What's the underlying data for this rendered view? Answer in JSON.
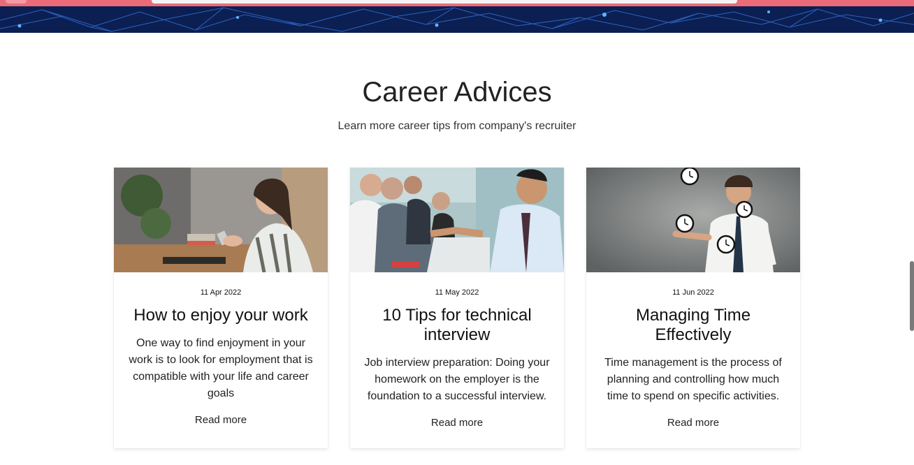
{
  "section": {
    "title": "Career Advices",
    "subtitle": "Learn more career tips from company's recruiter"
  },
  "cards": [
    {
      "image": "woman-smiling-at-phone-photo",
      "date": "11 Apr 2022",
      "title": "How to enjoy your work",
      "excerpt": "One way to find enjoyment in your work is to look for employment that is compatible with your life and career goals",
      "cta": "Read more"
    },
    {
      "image": "business-handshake-meeting-photo",
      "date": "11 May 2022",
      "title": "10 Tips for technical interview",
      "excerpt": "Job interview preparation: Doing your homework on the employer is the foundation to a successful interview.",
      "cta": "Read more"
    },
    {
      "image": "man-juggling-clocks-photo",
      "date": "11 Jun 2022",
      "title": "Managing Time Effectively",
      "excerpt": "Time management is the process of planning and controlling how much time to spend on specific activities.",
      "cta": "Read more"
    }
  ],
  "colors": {
    "top_bar": "#ec6b78",
    "banner": "#0c1f52",
    "banner_lines": "#2f6fd6"
  }
}
